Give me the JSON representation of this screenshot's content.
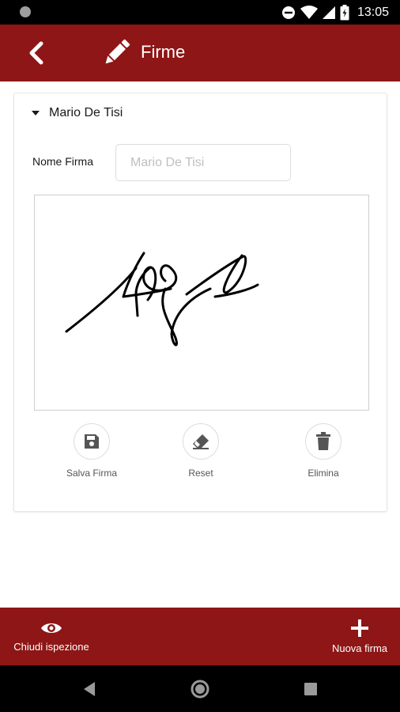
{
  "status_bar": {
    "time": "13:05",
    "icons": [
      "camera-dot-icon",
      "do-not-disturb-icon",
      "wifi-icon",
      "signal-icon",
      "battery-icon"
    ]
  },
  "app_bar": {
    "title": "Firme",
    "back_icon": "back-chevron-icon",
    "title_icon": "pencil-icon"
  },
  "card": {
    "header": "Mario De Tisi",
    "name_label": "Nome Firma",
    "name_placeholder": "Mario De Tisi",
    "name_value": "",
    "actions": [
      {
        "label": "Salva Firma",
        "icon": "save-icon"
      },
      {
        "label": "Reset",
        "icon": "eraser-icon"
      },
      {
        "label": "Elimina",
        "icon": "trash-icon"
      }
    ]
  },
  "bottom_bar": {
    "left_label": "Chiudi ispezione",
    "right_label": "Nuova firma",
    "left_icon": "eye-icon",
    "right_icon": "plus-icon"
  },
  "nav_bar": {
    "icons": [
      "nav-back-icon",
      "nav-home-icon",
      "nav-recents-icon"
    ]
  },
  "colors": {
    "primary": "#8e1616",
    "icon_gray": "#555555"
  }
}
